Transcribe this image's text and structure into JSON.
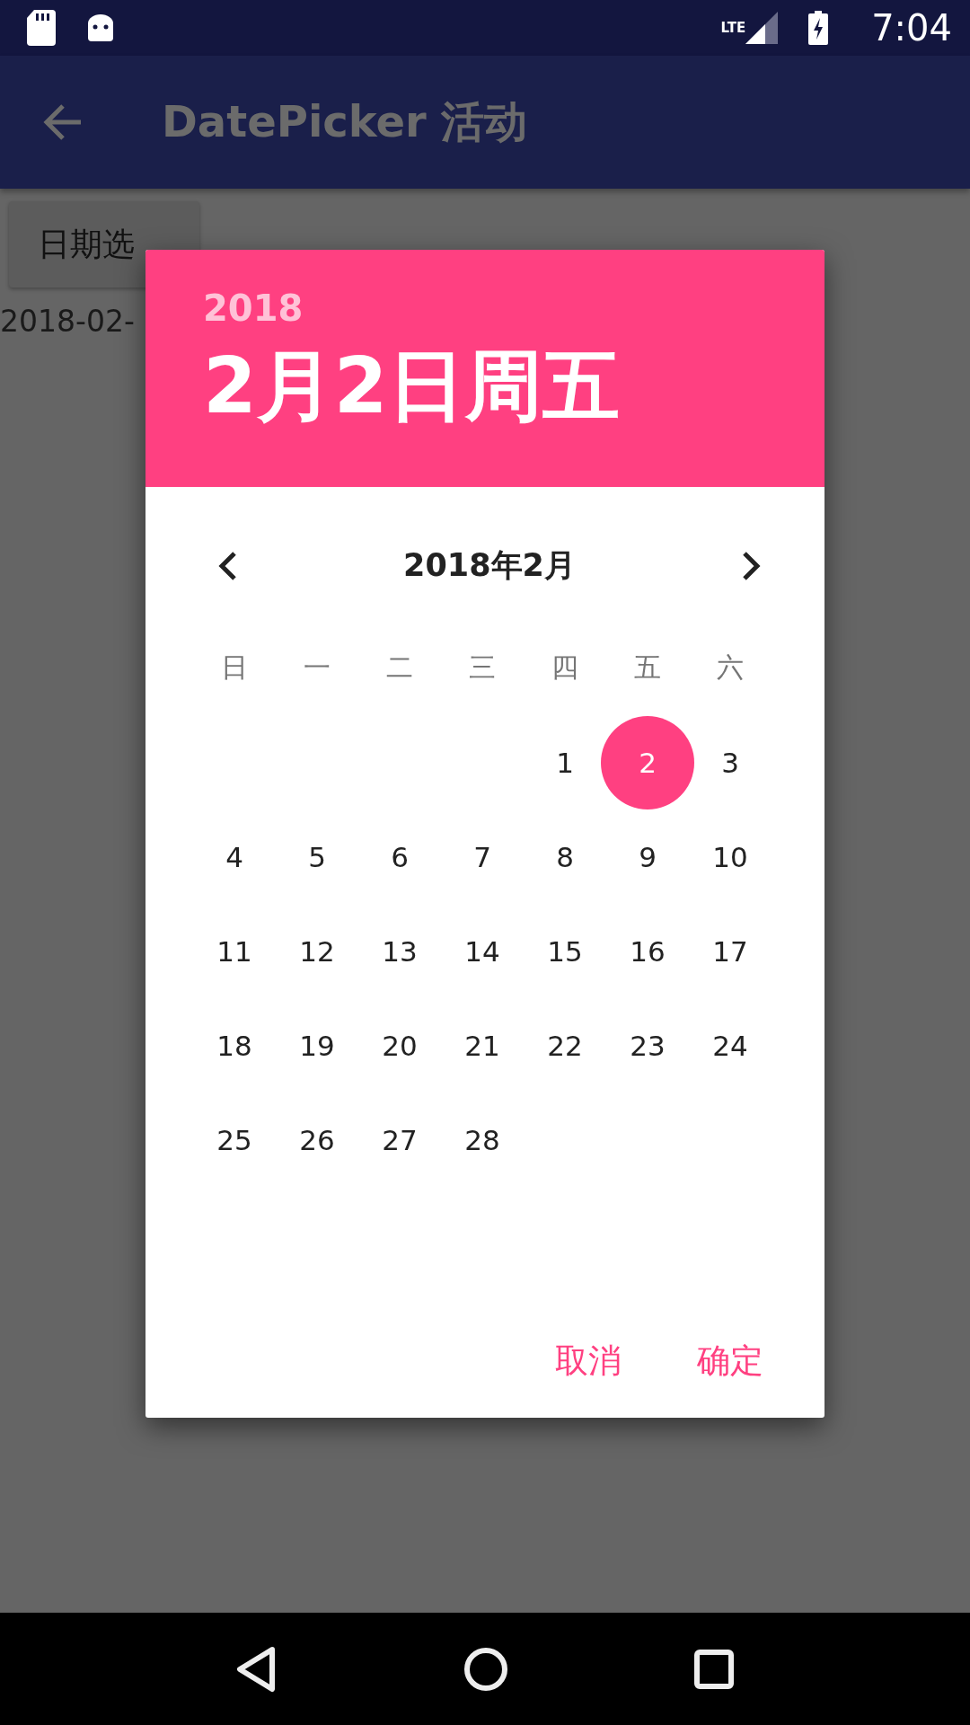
{
  "status_bar": {
    "time": "7:04",
    "network": "LTE"
  },
  "app_bar": {
    "title": "DatePicker 活动"
  },
  "page": {
    "button": "日期选",
    "date_text": "2018-02-"
  },
  "dialog": {
    "year": "2018",
    "date": "2月2日周五",
    "month": "2018年2月",
    "weekdays": [
      "日",
      "一",
      "二",
      "三",
      "四",
      "五",
      "六"
    ],
    "weeks": [
      {
        "pad_start": true,
        "days": [
          {
            "label": "1",
            "selected": false
          },
          {
            "label": "2",
            "selected": true
          },
          {
            "label": "3",
            "selected": false
          }
        ]
      },
      {
        "days": [
          {
            "label": "4",
            "selected": false
          },
          {
            "label": "5",
            "selected": false
          },
          {
            "label": "6",
            "selected": false
          },
          {
            "label": "7",
            "selected": false
          },
          {
            "label": "8",
            "selected": false
          },
          {
            "label": "9",
            "selected": false
          },
          {
            "label": "10",
            "selected": false
          }
        ]
      },
      {
        "days": [
          {
            "label": "11",
            "selected": false
          },
          {
            "label": "12",
            "selected": false
          },
          {
            "label": "13",
            "selected": false
          },
          {
            "label": "14",
            "selected": false
          },
          {
            "label": "15",
            "selected": false
          },
          {
            "label": "16",
            "selected": false
          },
          {
            "label": "17",
            "selected": false
          }
        ]
      },
      {
        "days": [
          {
            "label": "18",
            "selected": false
          },
          {
            "label": "19",
            "selected": false
          },
          {
            "label": "20",
            "selected": false
          },
          {
            "label": "21",
            "selected": false
          },
          {
            "label": "22",
            "selected": false
          },
          {
            "label": "23",
            "selected": false
          },
          {
            "label": "24",
            "selected": false
          }
        ]
      },
      {
        "pad_start": false,
        "days": [
          {
            "label": "25",
            "selected": false
          },
          {
            "label": "26",
            "selected": false
          },
          {
            "label": "27",
            "selected": false
          },
          {
            "label": "28",
            "selected": false
          }
        ]
      }
    ],
    "buttons": [
      "取消",
      "确定"
    ]
  }
}
